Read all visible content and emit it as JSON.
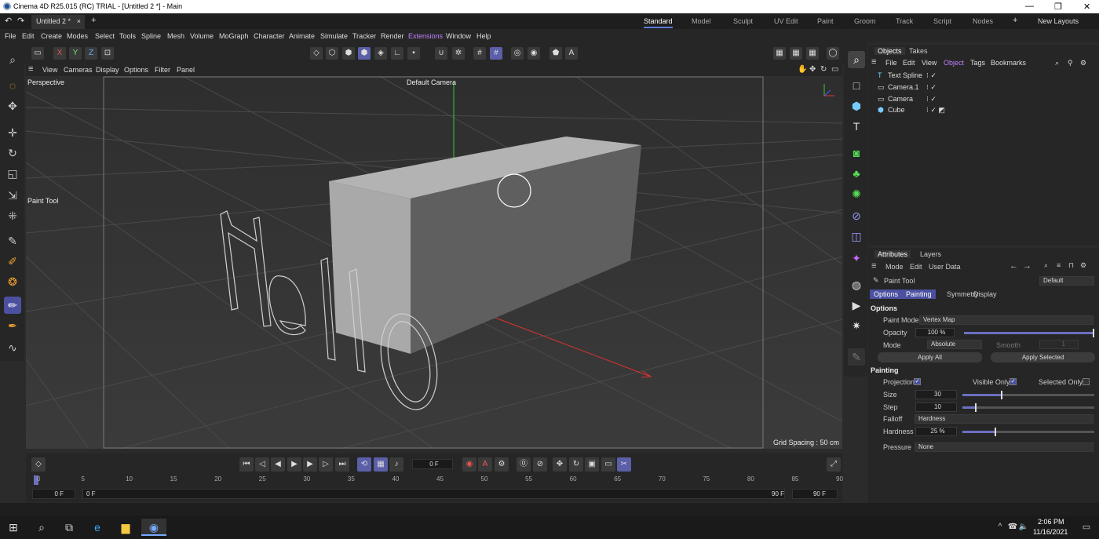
{
  "window": {
    "title": "Cinema 4D R25.015 (RC) TRIAL - [Untitled 2 *] - Main",
    "min": "—",
    "max": "❐",
    "close": "✕"
  },
  "tabs": {
    "doc": "Untitled 2 *",
    "close": "×",
    "add": "+"
  },
  "layouts": [
    "Standard",
    "Model",
    "Sculpt",
    "UV Edit",
    "Paint",
    "Groom",
    "Track",
    "Script",
    "Nodes",
    "+",
    "New Layouts"
  ],
  "menus": [
    "File",
    "Edit",
    "Create",
    "Modes",
    "Select",
    "Tools",
    "Spline",
    "Mesh",
    "Volume",
    "MoGraph",
    "Character",
    "Animate",
    "Simulate",
    "Tracker",
    "Render",
    "Extensions",
    "Window",
    "Help"
  ],
  "axes": {
    "x": "X",
    "y": "Y",
    "z": "Z"
  },
  "viewport": {
    "menus": [
      "View",
      "Cameras",
      "Display",
      "Options",
      "Filter",
      "Panel"
    ],
    "projection": "Perspective",
    "camera": "Default Camera",
    "tool_label": "Paint Tool",
    "grid_spacing": "Grid Spacing : 50 cm",
    "text_object": "Hello"
  },
  "timeline": {
    "frame": "0 F",
    "start_field": "0 F",
    "start_field2": "0 F",
    "end_field": "90 F",
    "end_field2": "90 F",
    "ticks": [
      "0",
      "5",
      "10",
      "15",
      "20",
      "25",
      "30",
      "35",
      "40",
      "45",
      "50",
      "55",
      "60",
      "65",
      "70",
      "75",
      "80",
      "85",
      "90"
    ]
  },
  "objects_panel": {
    "tabs": [
      "Objects",
      "Takes"
    ],
    "menus": [
      "File",
      "Edit",
      "View",
      "Object",
      "Tags",
      "Bookmarks"
    ],
    "items": [
      "Text Spline",
      "Camera.1",
      "Camera",
      "Cube"
    ]
  },
  "attributes": {
    "tabs": [
      "Attributes",
      "Layers"
    ],
    "menus": [
      "Mode",
      "Edit",
      "User Data"
    ],
    "tool": "Paint Tool",
    "preset": "Default",
    "subtabs": [
      "Options",
      "Painting",
      "Symmetry",
      "Display"
    ],
    "options_header": "Options",
    "paint_mode_label": "Paint Mode",
    "paint_mode": "Vertex Map",
    "opacity_label": "Opacity",
    "opacity": "100 %",
    "opacity_level": 1.0,
    "mode_label": "Mode",
    "mode": "Absolute",
    "smooth_label": "Smooth",
    "smooth": "1",
    "apply_all": "Apply All",
    "apply_selected": "Apply Selected",
    "painting_header": "Painting",
    "projection_label": "Projection",
    "visible_only_label": "Visible Only",
    "selected_only_label": "Selected Only",
    "size_label": "Size",
    "size": "30",
    "size_level": 0.3,
    "step_label": "Step",
    "step": "10",
    "step_level": 0.1,
    "falloff_label": "Falloff",
    "falloff": "Hardness",
    "hardness_label": "Hardness",
    "hardness": "25 %",
    "hardness_level": 0.25,
    "pressure_label": "Pressure",
    "pressure": "None"
  },
  "taskbar": {
    "time": "2:06 PM",
    "date": "11/16/2021"
  },
  "colors": {
    "accent": "#5b7bd8",
    "active_tool": "#4b50a0",
    "menu_highlight": "#c080ff"
  }
}
